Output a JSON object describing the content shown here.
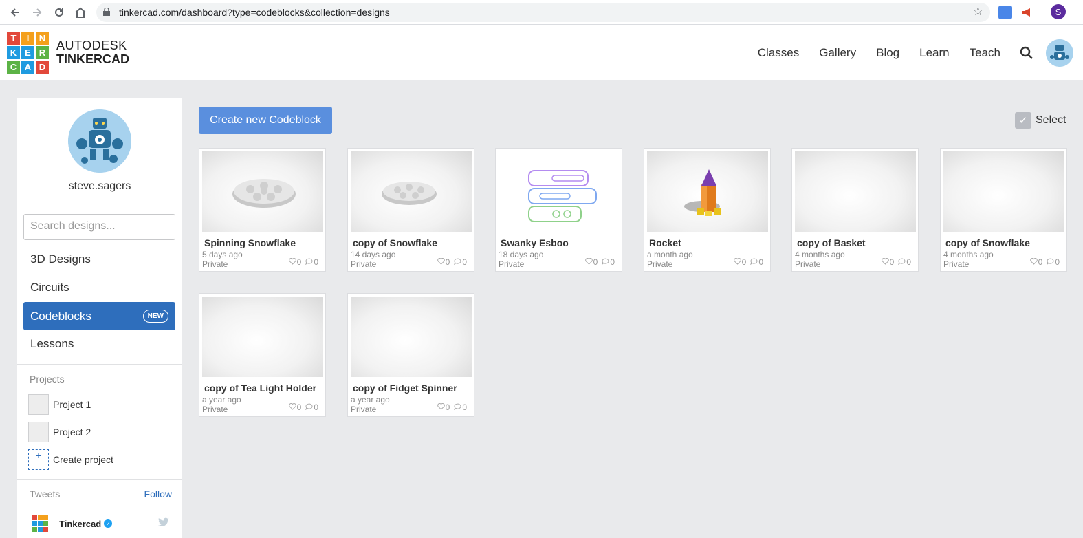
{
  "browser": {
    "url": "tinkercad.com/dashboard?type=codeblocks&collection=designs",
    "profile_initial": "S"
  },
  "header": {
    "logo_letters": [
      "T",
      "I",
      "N",
      "K",
      "E",
      "R",
      "C",
      "A",
      "D"
    ],
    "brand_line1": "AUTODESK",
    "brand_line2": "TINKERCAD",
    "nav": [
      "Classes",
      "Gallery",
      "Blog",
      "Learn",
      "Teach"
    ]
  },
  "sidebar": {
    "username": "steve.sagers",
    "search_placeholder": "Search designs...",
    "items": [
      {
        "label": "3D Designs"
      },
      {
        "label": "Circuits"
      },
      {
        "label": "Codeblocks",
        "badge": "NEW",
        "active": true
      },
      {
        "label": "Lessons"
      }
    ],
    "projects_label": "Projects",
    "projects": [
      "Project 1",
      "Project 2"
    ],
    "create_project": "Create project",
    "create_plus": "+",
    "tweets_label": "Tweets",
    "follow_label": "Follow",
    "tweet_author": "Tinkercad"
  },
  "main": {
    "create_button": "Create new Codeblock",
    "select_label": "Select",
    "designs": [
      {
        "title": "Spinning Snowflake",
        "time": "5 days ago",
        "privacy": "Private",
        "likes": "0",
        "comments": "0",
        "thumb": "snowflake"
      },
      {
        "title": "copy of Snowflake",
        "time": "14 days ago",
        "privacy": "Private",
        "likes": "0",
        "comments": "0",
        "thumb": "snowflake-small"
      },
      {
        "title": "Swanky Esboo",
        "time": "18 days ago",
        "privacy": "Private",
        "likes": "0",
        "comments": "0",
        "thumb": "codeblocks"
      },
      {
        "title": "Rocket",
        "time": "a month ago",
        "privacy": "Private",
        "likes": "0",
        "comments": "0",
        "thumb": "rocket"
      },
      {
        "title": "copy of Basket",
        "time": "4 months ago",
        "privacy": "Private",
        "likes": "0",
        "comments": "0",
        "thumb": "blank"
      },
      {
        "title": "copy of Snowflake",
        "time": "4 months ago",
        "privacy": "Private",
        "likes": "0",
        "comments": "0",
        "thumb": "blank"
      },
      {
        "title": "copy of Tea Light Holder",
        "time": "a year ago",
        "privacy": "Private",
        "likes": "0",
        "comments": "0",
        "thumb": "blank"
      },
      {
        "title": "copy of Fidget Spinner",
        "time": "a year ago",
        "privacy": "Private",
        "likes": "0",
        "comments": "0",
        "thumb": "blank"
      }
    ]
  },
  "colors": {
    "accent": "#2e6ebc",
    "create_button": "#5a8fde",
    "logo_tiles": [
      "#e2483b",
      "#f4a01c",
      "#f4a01c",
      "#1f9be0",
      "#1f9be0",
      "#5cb346",
      "#5cb346",
      "#1f9be0",
      "#e2483b"
    ]
  }
}
